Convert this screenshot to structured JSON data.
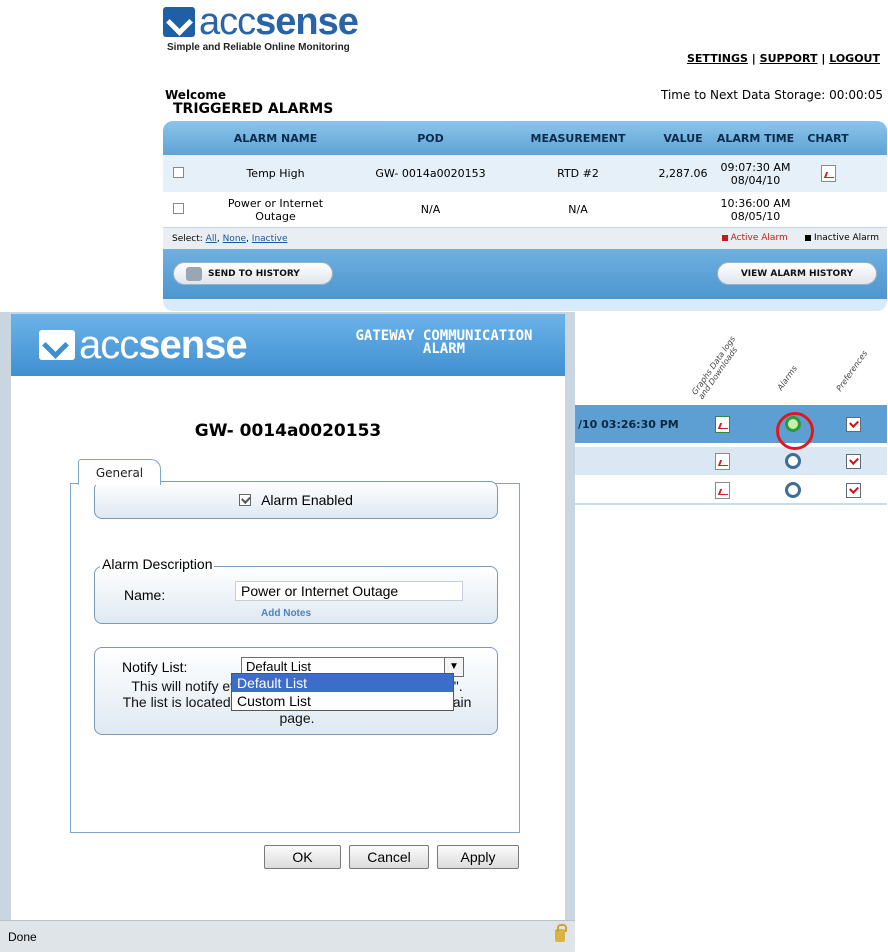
{
  "brand": {
    "word_a": "acc",
    "word_b": "sense",
    "tagline": "Simple and Reliable Online Monitoring"
  },
  "topnav": {
    "settings": "SETTINGS",
    "support": "SUPPORT",
    "logout": "LOGOUT",
    "sep": "|"
  },
  "welcome": "Welcome",
  "next_storage": "Time to Next Data Storage: 00:00:05",
  "triggered": {
    "title": "TRIGGERED ALARMS",
    "headers": {
      "name": "ALARM NAME",
      "pod": "POD",
      "measurement": "MEASUREMENT",
      "value": "VALUE",
      "time": "ALARM TIME",
      "chart": "CHART"
    },
    "rows": [
      {
        "name": "Temp High",
        "pod": "GW- 0014a0020153",
        "measurement": "RTD #2",
        "value": "2,287.06",
        "time": "09:07:30 AM",
        "date": "08/04/10"
      },
      {
        "name_line1": "Power or Internet",
        "name_line2": "Outage",
        "pod": "N/A",
        "measurement": "N/A",
        "value": "",
        "time": "10:36:00 AM",
        "date": "08/05/10"
      }
    ],
    "select_label": "Select:",
    "select_all": "All",
    "select_none": "None",
    "select_inactive": "Inactive",
    "legend_active": "Active Alarm",
    "legend_inactive": "Inactive Alarm",
    "send_button": "SEND TO HISTORY",
    "history_button": "VIEW ALARM HISTORY"
  },
  "device_grid": {
    "col_graphs_1": "Graphs Data logs",
    "col_graphs_2": "and Downloads",
    "col_alarms": "Alarms",
    "col_prefs": "Preferences",
    "row1_time": "/10 03:26:30 PM"
  },
  "dialog": {
    "title_line1": "GATEWAY COMMUNICATION",
    "title_line2": "ALARM",
    "gateway": "GW- 0014a0020153",
    "tab_general": "General",
    "alarm_enabled": "Alarm Enabled",
    "description_legend": "Alarm Description",
    "name_label": "Name:",
    "name_value": "Power or Internet Outage",
    "add_notes": "Add Notes",
    "notify_label": "Notify List:",
    "notify_selected": "Default List",
    "notify_options": [
      "Default List",
      "Custom List"
    ],
    "notify_text_line1": "This will notify eve",
    "notify_text_line1_end": "t\".",
    "notify_text_line2": "The list is located i",
    "notify_text_line2_end": "ain",
    "notify_text_line3": "page.",
    "ok": "OK",
    "cancel": "Cancel",
    "apply": "Apply",
    "status": "Done"
  }
}
